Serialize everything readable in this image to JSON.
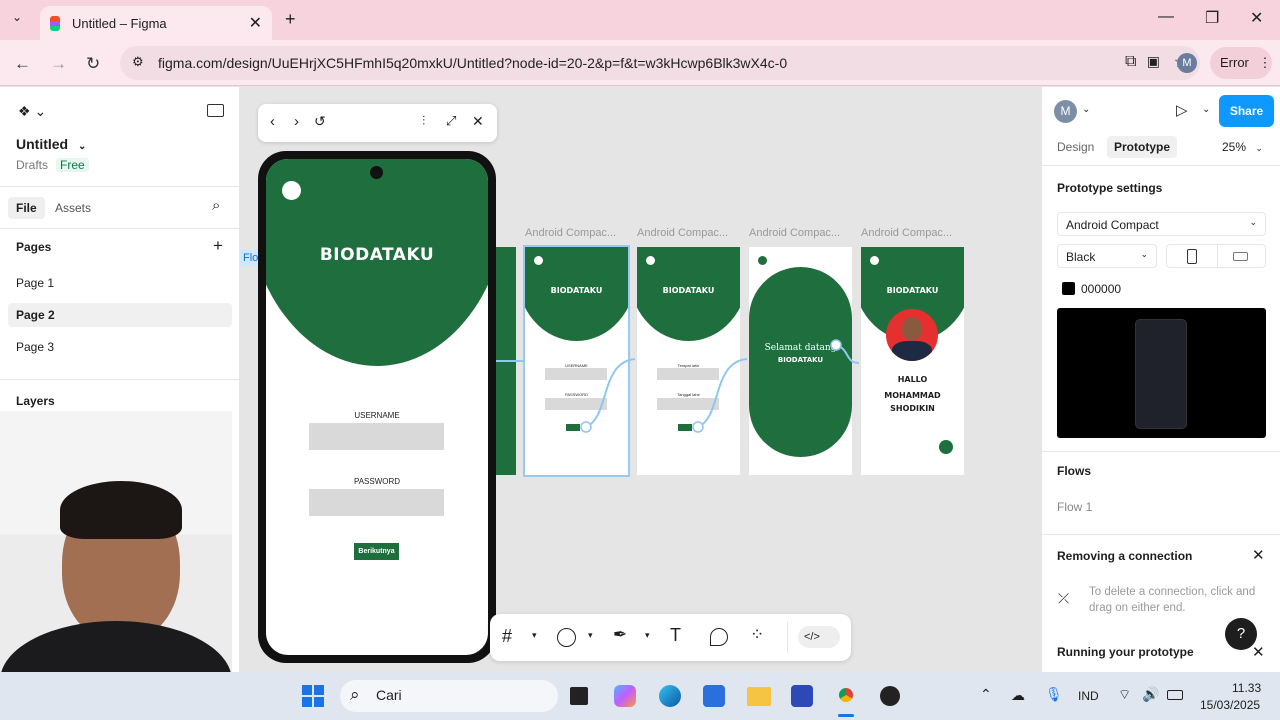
{
  "browser": {
    "tab_title": "Untitled – Figma",
    "url": "figma.com/design/UuEHrjXC5HFmhI5q20mxkU/Untitled?node-id=20-2&p=f&t=w3kHcwp6Blk3wX4c-0",
    "profile_initial": "M",
    "error_label": "Error"
  },
  "left_panel": {
    "file_title": "Untitled",
    "drafts_label": "Drafts",
    "plan_badge": "Free",
    "tabs": [
      "File",
      "Assets"
    ],
    "pages_heading": "Pages",
    "pages": [
      "Page 1",
      "Page 2",
      "Page 3"
    ],
    "selected_page": "Page 2",
    "layers_heading": "Layers"
  },
  "canvas": {
    "frame_labels": [
      "Android Compac...",
      "Android Compac...",
      "Android Compac...",
      "Android Compac..."
    ],
    "flow_tag": "Flow",
    "preview": {
      "title": "BIODATAKU",
      "username_label": "USERNAME",
      "password_label": "PASSWORD",
      "button_label": "Berikutnya"
    },
    "frame_texts": {
      "f1_label1": "USERNAME",
      "f1_label2": "PASSWORD",
      "f2_label1": "Tempat lahir",
      "f2_label2": "Tanggal lahir",
      "f3_greeting": "Selamat datang",
      "f3_title": "BIODATAKU",
      "f4_hello": "HALLO",
      "f4_name1": "MOHAMMAD",
      "f4_name2": "SHODIKIN"
    }
  },
  "right_panel": {
    "avatar_initial": "M",
    "share_label": "Share",
    "tabs": [
      "Design",
      "Prototype"
    ],
    "active_tab": "Prototype",
    "zoom": "25%",
    "settings_heading": "Prototype settings",
    "device": "Android Compact",
    "model": "Black",
    "color_hex": "000000",
    "flows_heading": "Flows",
    "flow_item": "Flow 1",
    "tip_title": "Removing a connection",
    "tip_body": "To delete a connection, click and drag on either end.",
    "running_title": "Running your prototype",
    "help": "?"
  },
  "taskbar": {
    "search_placeholder": "Cari",
    "lang": "IND",
    "time": "11.33",
    "date": "15/03/2025"
  },
  "colors": {
    "brand_green": "#1f6f3e",
    "figma_blue": "#0d99ff",
    "tab_pink": "#f7d3de"
  }
}
